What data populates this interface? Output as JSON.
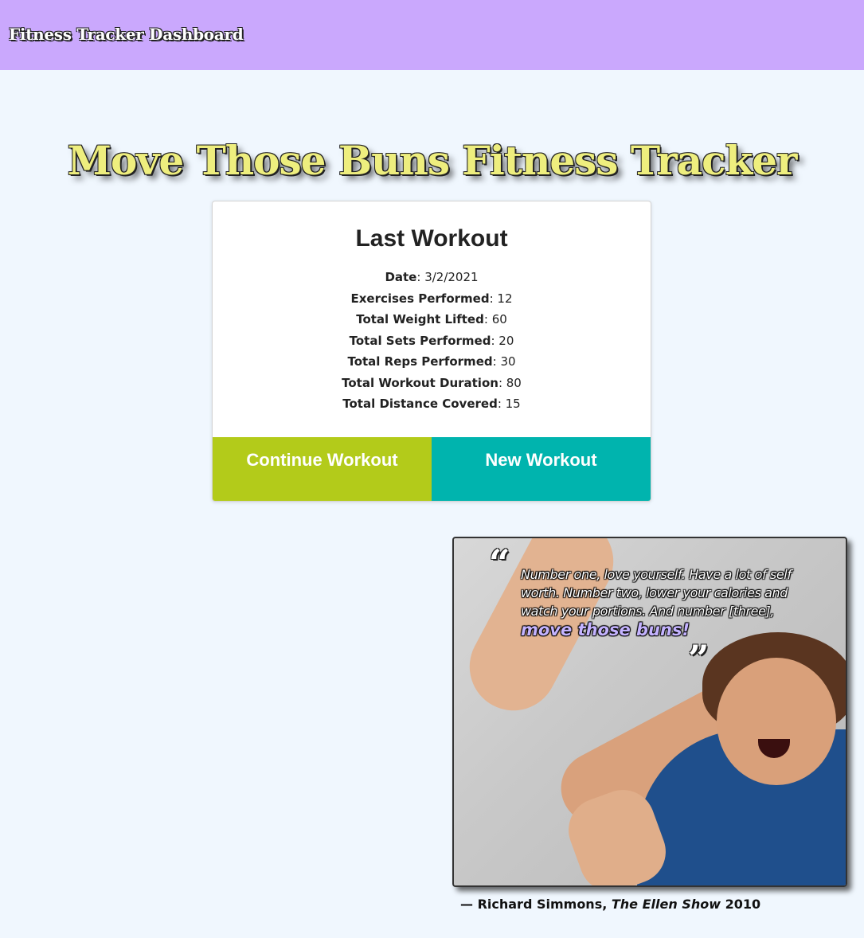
{
  "nav": {
    "brand": "Fitness Tracker Dashboard"
  },
  "hero": {
    "title": "Move Those Buns Fitness Tracker"
  },
  "last_workout": {
    "heading": "Last Workout",
    "stats": [
      {
        "label": "Date",
        "value": "3/2/2021"
      },
      {
        "label": "Exercises Performed",
        "value": "12"
      },
      {
        "label": "Total Weight Lifted",
        "value": "60"
      },
      {
        "label": "Total Sets Performed",
        "value": "20"
      },
      {
        "label": "Total Reps Performed",
        "value": "30"
      },
      {
        "label": "Total Workout Duration",
        "value": "80"
      },
      {
        "label": "Total Distance Covered",
        "value": "15"
      }
    ],
    "continue_label": "Continue Workout",
    "new_label": "New Workout"
  },
  "quote": {
    "open_mark": "“",
    "close_mark": "”",
    "text": "Number one, love yourself. Have a lot of self worth. Number two, lower your calories and watch your portions. And number [three],",
    "emphasis": "move those buns!",
    "author_prefix": "— Richard Simmons,",
    "source": "The Ellen Show",
    "year": "2010"
  },
  "colors": {
    "topbar": "#caa8fd",
    "page_bg": "#f0f7fe",
    "title_fill": "#eeee7e",
    "continue_button": "#b3cb1a",
    "new_button": "#00b4ae",
    "quote_emphasis": "#c4b3ff"
  }
}
